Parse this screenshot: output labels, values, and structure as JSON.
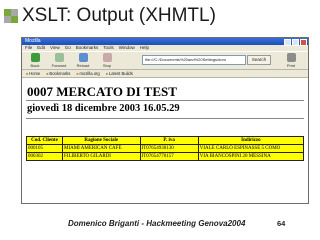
{
  "slide": {
    "title": "XSLT: Output (XHMTL)",
    "footer": "Domenico Briganti - Hackmeeting Genova2004",
    "page_number": "64"
  },
  "browser": {
    "window_title": "Mozilla",
    "menu": [
      "File",
      "Edit",
      "View",
      "Go",
      "Bookmarks",
      "Tools",
      "Window",
      "Help"
    ],
    "toolbar": {
      "back": "Back",
      "forward": "Forward",
      "reload": "Reload",
      "stop": "Stop",
      "search": "Search",
      "print": "Print"
    },
    "url": "file:///C:/Documents%20and%20Settings/dom",
    "bookmarks": [
      "Home",
      "Bookmarks",
      "mozilla.org",
      "Latest Builds"
    ]
  },
  "document": {
    "heading": "0007 MERCATO DI TEST",
    "date": "giovedì 18 dicembre 2003 16.05.29",
    "table": {
      "headers": [
        "Cod. Cliente",
        "Ragione Sociale",
        "P. iva",
        "Indirizzo"
      ],
      "rows": [
        [
          "000105",
          "MIAMI AMERICAN CAFE",
          "IT07654930130",
          "VIALE CARLO ESPINASSE 5 COMO"
        ],
        [
          "000302",
          "FILIBERTO GILARDI",
          "IT07654770157",
          "VIA BIANCOSPINI 20 MESSINA"
        ]
      ]
    }
  },
  "colors": {
    "table_bg": "#ffff00",
    "bullet_green": "#7aa63a",
    "bullet_gray": "#a8a8a8"
  }
}
